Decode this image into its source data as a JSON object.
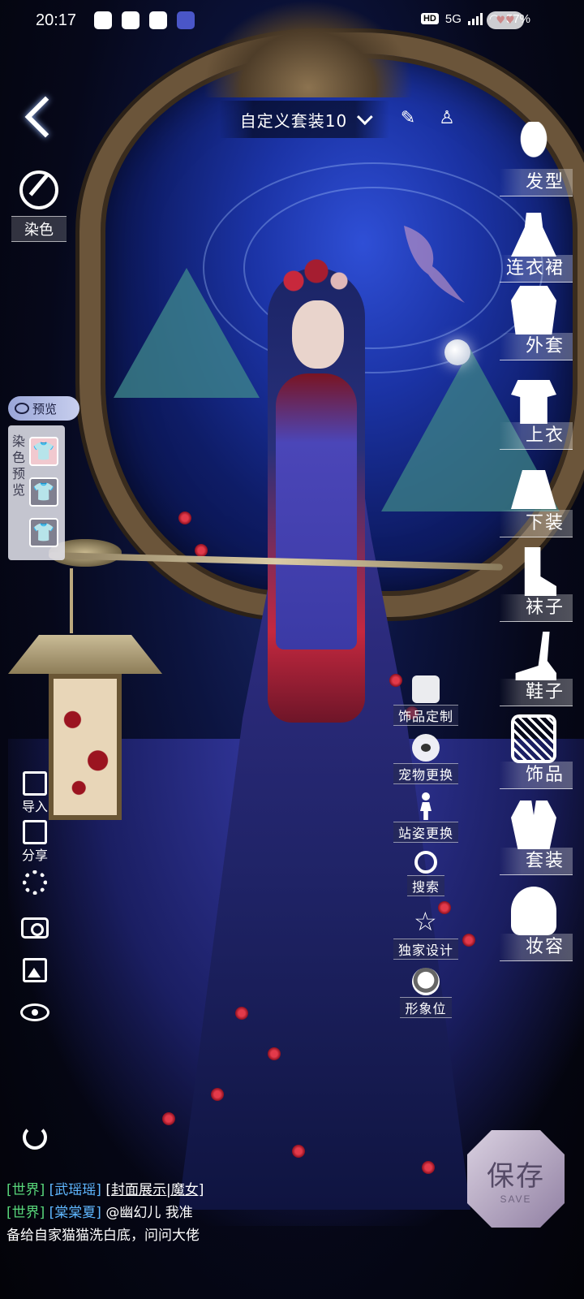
{
  "status_bar": {
    "time": "20:17",
    "apps": [
      "wechat-icon",
      "qq-icon",
      "message-icon",
      "app-icon"
    ],
    "network_badge": "HD",
    "network_type": "5G",
    "battery": "57%"
  },
  "header": {
    "outfit_name": "自定义套装10"
  },
  "left_panel": {
    "dye_label": "染色",
    "preview_pill": "预览",
    "dye_preview_label": "染色预览",
    "tools": {
      "import": "导入",
      "share": "分享"
    }
  },
  "categories": [
    {
      "id": "hair",
      "label": "发型"
    },
    {
      "id": "dress",
      "label": "连衣裙"
    },
    {
      "id": "coat",
      "label": "外套"
    },
    {
      "id": "top",
      "label": "上衣"
    },
    {
      "id": "bottom",
      "label": "下装"
    },
    {
      "id": "socks",
      "label": "袜子"
    },
    {
      "id": "shoes",
      "label": "鞋子"
    },
    {
      "id": "accessories",
      "label": "饰品"
    },
    {
      "id": "suit",
      "label": "套装"
    },
    {
      "id": "makeup",
      "label": "妆容"
    }
  ],
  "features": [
    {
      "id": "accessory-custom",
      "label": "饰品定制"
    },
    {
      "id": "pet-change",
      "label": "宠物更换"
    },
    {
      "id": "pose-change",
      "label": "站姿更换"
    },
    {
      "id": "search",
      "label": "搜索"
    },
    {
      "id": "exclusive-design",
      "label": "独家设计"
    },
    {
      "id": "image-slot",
      "label": "形象位"
    }
  ],
  "save": {
    "label": "保存",
    "sub": "SAVE"
  },
  "chat": [
    {
      "channel": "[世界]",
      "user": "[武瑶瑶]",
      "text": "[封面展示|魔女]"
    },
    {
      "channel": "[世界]",
      "user": "[棠棠夏]",
      "text": "@幽幻儿 我准"
    },
    {
      "text": "备给自家猫猫洗白底，问问大佬"
    }
  ],
  "colors": {
    "accent_green": "#58d67a",
    "accent_blue": "#5fb7ff",
    "frame_gold": "#6b553a"
  }
}
